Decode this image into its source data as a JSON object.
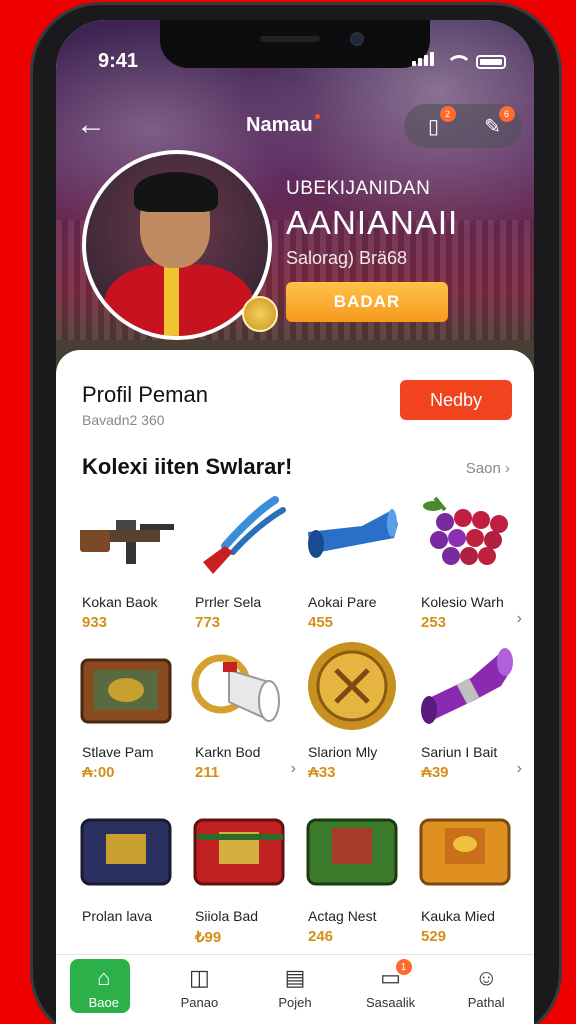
{
  "status_bar": {
    "time": "9:41"
  },
  "header": {
    "title": "Namau",
    "hero_subtitle": "UBEKIJANIDAN",
    "hero_name": "AANIANAII",
    "hero_caption": "Salorag) Brä68",
    "hero_button": "BADAR",
    "icon_badges": [
      "2",
      "6"
    ]
  },
  "profile": {
    "title": "Profil Peman",
    "subtitle": "Bavadn2 360",
    "action_button": "Nedby"
  },
  "collection": {
    "title": "Kolexi iiten Swlarar!",
    "see_all": "Saon",
    "items": [
      {
        "name": "Kokan Baok",
        "price": "933",
        "icon": "rifle-icon"
      },
      {
        "name": "Prrler Sela",
        "price": "773",
        "icon": "pliers-icon"
      },
      {
        "name": "Aokai Pare",
        "price": "455",
        "icon": "horn-icon"
      },
      {
        "name": "Kolesio Warh",
        "price": "253",
        "icon": "grapes-icon"
      },
      {
        "name": "Stlave Pam",
        "price": "₳:00",
        "icon": "chest-icon"
      },
      {
        "name": "Karkn Bod",
        "price": "211",
        "icon": "megaphone-icon"
      },
      {
        "name": "Slarion Mly",
        "price": "₳33",
        "icon": "gold-coin-icon"
      },
      {
        "name": "Sariun I Bait",
        "price": "₳39",
        "icon": "purple-horn-icon"
      },
      {
        "name": "Prolan lava",
        "price": "",
        "icon": "blue-chest-icon"
      },
      {
        "name": "Siiola Bad",
        "price": "₺99",
        "icon": "red-chest-icon"
      },
      {
        "name": "Actag Nest",
        "price": "246",
        "icon": "green-chest-icon"
      },
      {
        "name": "Kauka Mied",
        "price": "529",
        "icon": "orange-chest-icon"
      }
    ]
  },
  "bottom_nav": {
    "items": [
      {
        "label": "Baoe",
        "icon": "home-icon"
      },
      {
        "label": "Panao",
        "icon": "box-icon"
      },
      {
        "label": "Pojeh",
        "icon": "document-icon"
      },
      {
        "label": "Sasaalik",
        "icon": "chat-icon",
        "badge": "1"
      },
      {
        "label": "Pathal",
        "icon": "user-icon"
      }
    ]
  },
  "colors": {
    "accent": "#f0431e",
    "gold": "#d4901a",
    "nav_active": "#2cb04a",
    "background": "#ee0000"
  }
}
